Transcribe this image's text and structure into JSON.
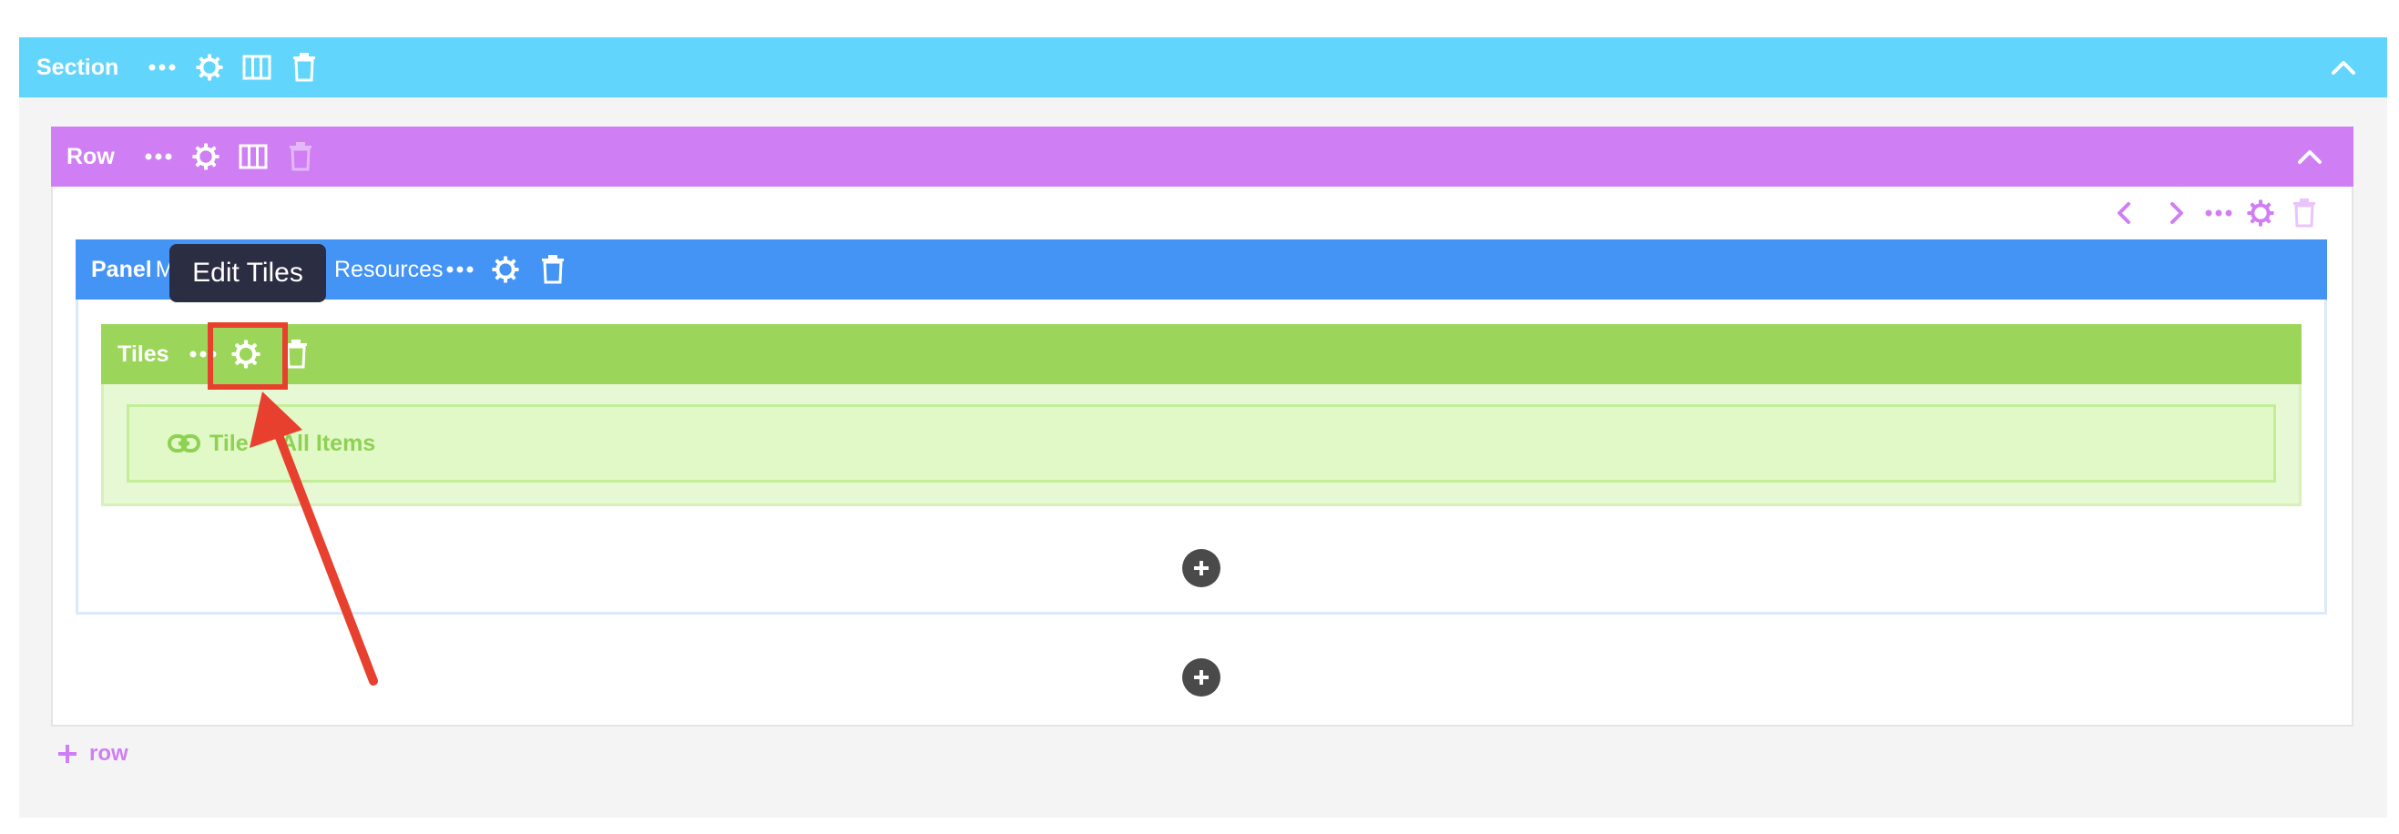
{
  "section": {
    "label": "Section"
  },
  "row": {
    "label": "Row"
  },
  "panel": {
    "label": "Panel",
    "label_partial": "M",
    "label_rest": "Resources"
  },
  "tiles": {
    "label": "Tiles"
  },
  "tooltip": {
    "text": "Edit Tiles"
  },
  "content_item": {
    "text_left": "Tile",
    "text_right": "All Items"
  },
  "add_row": {
    "label": "row"
  },
  "icons": {
    "more": "more-dots-icon",
    "settings": "gear-icon",
    "columns": "columns-icon",
    "delete": "trash-icon",
    "collapse": "chevron-up-icon",
    "prev": "chevron-left-icon",
    "next": "chevron-right-icon",
    "add": "plus-icon",
    "link": "link-icon"
  },
  "colors": {
    "section_bar": "#61d5fb",
    "row_bar": "#cf7ef4",
    "panel_bar": "#4494f6",
    "tiles_bar": "#9bd65a",
    "tiles_body": "#e7f8d4",
    "item_bg": "#e1f8c7",
    "item_text": "#8fd153",
    "highlight": "#e8402e",
    "tooltip_bg": "#2b2d42",
    "canvas_bg": "#f4f4f4"
  }
}
